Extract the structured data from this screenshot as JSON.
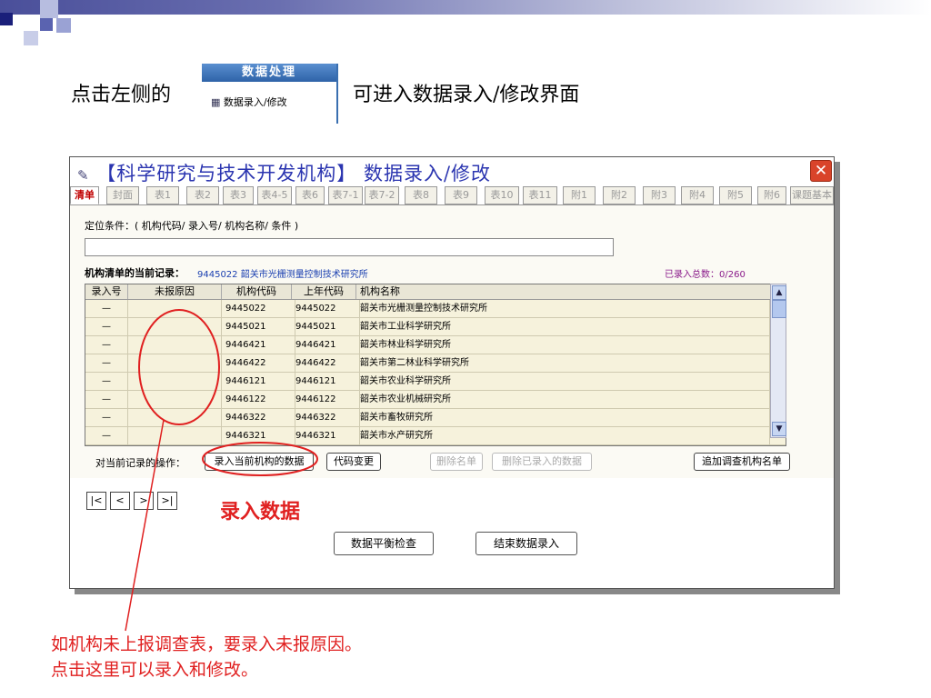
{
  "slide": {
    "intro_before": "点击左侧的",
    "intro_after": "可进入数据录入/修改界面",
    "menu_header": "数据处理",
    "menu_item": "数据录入/修改",
    "annotation_center": "录入数据",
    "annotation_bottom_1": "如机构未上报调查表，要录入未报原因。",
    "annotation_bottom_2": "点击这里可以录入和修改。"
  },
  "window": {
    "title": "【科学研究与技术开发机构】  数据录入/修改",
    "close": "✕",
    "tabs": [
      "清单",
      "封面",
      "表1",
      "表2",
      "表3",
      "表4-5",
      "表6",
      "表7-1",
      "表7-2",
      "表8",
      "表9",
      "表10",
      "表11",
      "附1",
      "附2",
      "附3",
      "附4",
      "附5",
      "附6",
      "课题基本"
    ],
    "locate_label": "定位条件：( 机构代码/ 录入号/ 机构名称/ 条件 )",
    "locate_value": "",
    "current_label": "机构清单的当前记录：",
    "current_value": "9445022 韶关市光栅测量控制技术研究所",
    "total_label": "已录入总数：0/260",
    "columns": [
      "录入号",
      "未报原因",
      "机构代码",
      "上年代码",
      "机构名称"
    ],
    "rows": [
      [
        "—",
        "",
        "9445022",
        "9445022",
        "韶关市光栅测量控制技术研究所"
      ],
      [
        "—",
        "",
        "9445021",
        "9445021",
        "韶关市工业科学研究所"
      ],
      [
        "—",
        "",
        "9446421",
        "9446421",
        "韶关市林业科学研究所"
      ],
      [
        "—",
        "",
        "9446422",
        "9446422",
        "韶关市第二林业科学研究所"
      ],
      [
        "—",
        "",
        "9446121",
        "9446121",
        "韶关市农业科学研究所"
      ],
      [
        "—",
        "",
        "9446122",
        "9446122",
        "韶关市农业机械研究所"
      ],
      [
        "—",
        "",
        "9446322",
        "9446322",
        "韶关市畜牧研究所"
      ],
      [
        "—",
        "",
        "9446321",
        "9446321",
        "韶关市水产研究所"
      ]
    ],
    "ops_label": "对当前记录的操作：",
    "btn_enter": "录入当前机构的数据",
    "btn_change_code": "代码变更",
    "btn_delete_list": "删除名单",
    "btn_delete_data": "删除已录入的数据",
    "btn_add_list": "追加调查机构名单",
    "nav": [
      "|<",
      "<",
      ">",
      ">|"
    ],
    "btn_balance": "数据平衡检查",
    "btn_finish": "结束数据录入"
  },
  "colors": {
    "annotation": "#e02020",
    "title": "#2b35b0",
    "active_tab": "#c00000"
  }
}
